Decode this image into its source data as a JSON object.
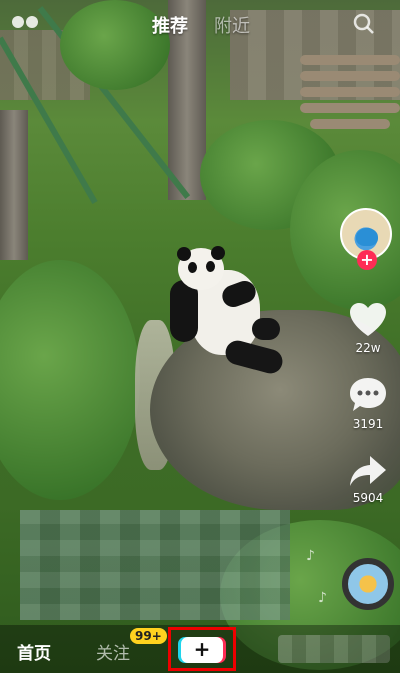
{
  "topbar": {
    "live_icon": "live-glasses-icon",
    "tabs": [
      {
        "label": "推荐",
        "active": true
      },
      {
        "label": "附近",
        "active": false
      }
    ],
    "search_icon": "search-icon"
  },
  "sidebar": {
    "avatar_icon": "creator-avatar",
    "follow_label": "+",
    "like": {
      "icon": "heart-icon",
      "count": "22w"
    },
    "comment": {
      "icon": "comment-bubble-icon",
      "count": "3191"
    },
    "share": {
      "icon": "share-arrow-icon",
      "count": "5904"
    },
    "music_icon": "music-disc-icon"
  },
  "bottom_nav": {
    "home_label": "首页",
    "follow_label": "关注",
    "follow_badge": "99+",
    "create_label": "+"
  },
  "colors": {
    "accent": "#fe2c55",
    "accent_cyan": "#20d5ec",
    "badge": "#ffd21f",
    "highlight_box": "#ee0000"
  }
}
